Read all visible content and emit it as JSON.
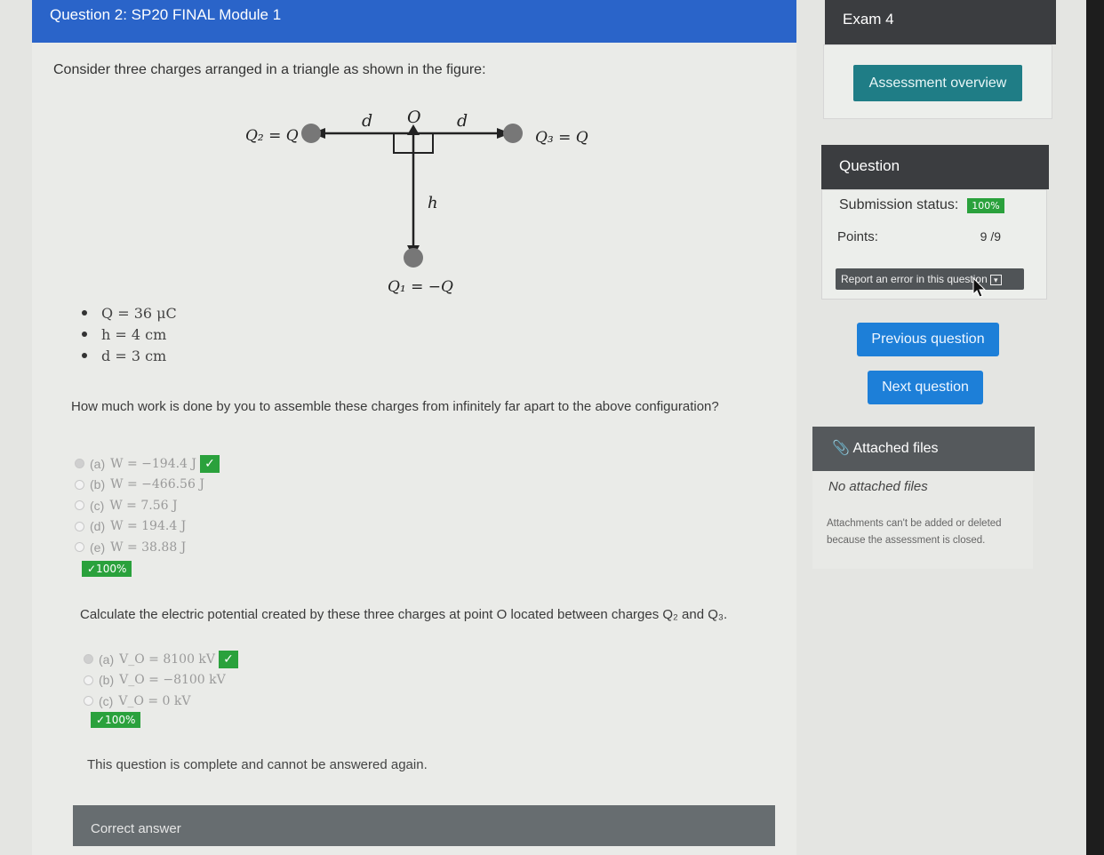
{
  "header": {
    "title": "Question 2: SP20 FINAL Module 1"
  },
  "question": {
    "intro": "Consider three charges arranged in a triangle as shown in the figure:",
    "figure": {
      "q2_label": "Q₂ = Q",
      "q3_label": "Q₃ = Q",
      "q1_label": "Q₁ = −Q",
      "d_label_left": "d",
      "d_label_right": "d",
      "o_label": "O",
      "h_label": "h"
    },
    "givens": [
      "Q = 36 μC",
      "h = 4  cm",
      "d = 3  cm"
    ],
    "part1": {
      "prompt": "How much work is done by you to assemble these charges from infinitely far apart to the above configuration?",
      "options": [
        {
          "label": "(a)",
          "text": "W = −194.4 J"
        },
        {
          "label": "(b)",
          "text": "W = −466.56 J"
        },
        {
          "label": "(c)",
          "text": "W = 7.56 J"
        },
        {
          "label": "(d)",
          "text": "W = 194.4 J"
        },
        {
          "label": "(e)",
          "text": "W = 38.88 J"
        }
      ],
      "check": "✓",
      "score": "✓100%"
    },
    "part2": {
      "prompt": "Calculate the electric potential created by these three charges at point O located between charges Q₂ and Q₃.",
      "options": [
        {
          "label": "(a)",
          "text": "V_O = 8100 kV"
        },
        {
          "label": "(b)",
          "text": "V_O = −8100 kV"
        },
        {
          "label": "(c)",
          "text": "V_O = 0 kV"
        }
      ],
      "check": "✓",
      "score": "✓100%"
    },
    "complete_message": "This question is complete and cannot be answered again.",
    "correct_answer_label": "Correct answer"
  },
  "sidebar": {
    "exam_title": "Exam 4",
    "overview_button": "Assessment overview",
    "question_heading": "Question",
    "submission_status_label": "Submission status:",
    "submission_status_value": "100%",
    "points_label": "Points:",
    "points_value": "9 /9",
    "report_button": "Report an error in this question",
    "prev_button": "Previous question",
    "next_button": "Next question",
    "files_heading": "Attached files",
    "no_files": "No attached files",
    "attach_note": "Attachments can't be added or deleted because the assessment is closed."
  },
  "colors": {
    "header_blue": "#2a64c9",
    "teal_button": "#1f7d86",
    "blue_button": "#1d7fd8",
    "success_green": "#2aa13c",
    "dark_panel": "#3b3d40"
  }
}
